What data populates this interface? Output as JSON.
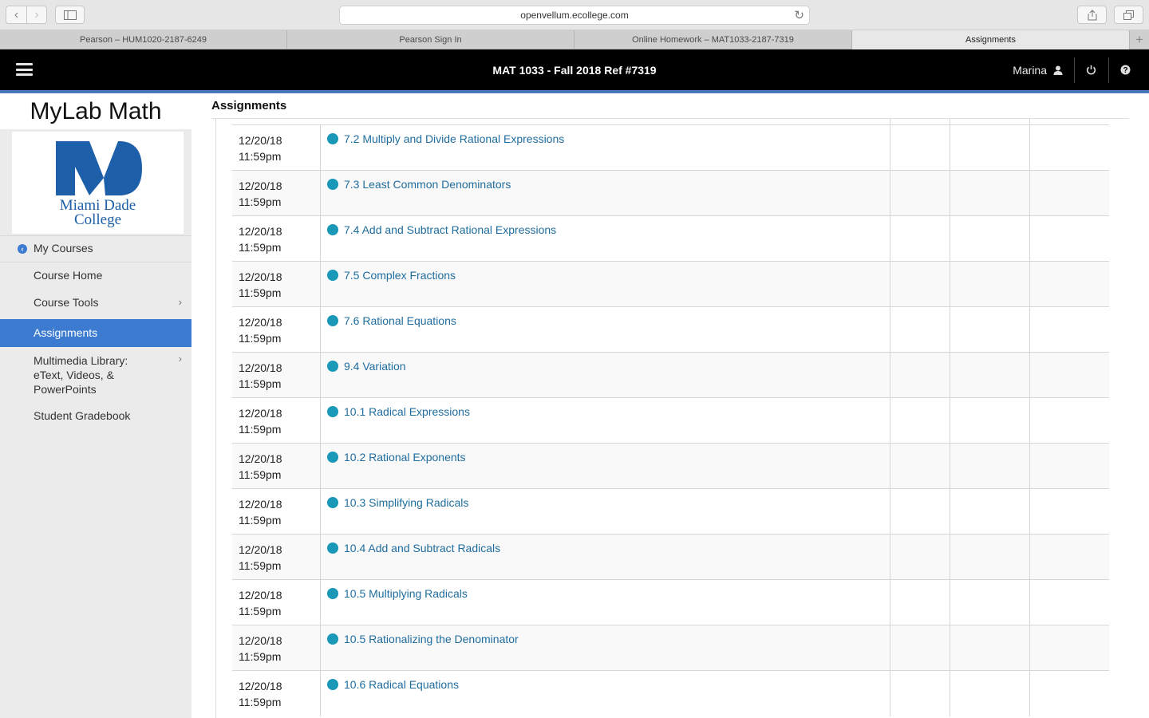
{
  "browser": {
    "url": "openvellum.ecollege.com",
    "tabs": [
      {
        "label": "Pearson – HUM1020-2187-6249",
        "active": false
      },
      {
        "label": "Pearson Sign In",
        "active": false
      },
      {
        "label": "Online Homework – MAT1033-2187-7319",
        "active": false
      },
      {
        "label": "Assignments",
        "active": true
      }
    ],
    "new_tab": "+"
  },
  "header": {
    "course_title": "MAT 1033 - Fall 2018 Ref #7319",
    "user": "Marina",
    "icons": [
      "menu-icon",
      "user-icon",
      "power-icon",
      "help-icon"
    ]
  },
  "sidebar": {
    "brand": "MyLab Math",
    "logo": {
      "line1": "Miami Dade",
      "line2": "College"
    },
    "items": [
      {
        "label": "My Courses",
        "icon": "back-circle-icon"
      },
      {
        "label": "Course Home"
      },
      {
        "label": "Course Tools",
        "icon": "chevron-right-icon"
      },
      {
        "label": "Assignments",
        "active": true
      },
      {
        "label": "Multimedia Library:",
        "line2": "eText, Videos, &",
        "line3": "PowerPoints",
        "icon": "chevron-right-icon"
      },
      {
        "label": "Student Gradebook"
      }
    ]
  },
  "main": {
    "title": "Assignments",
    "rows": [
      {
        "date": "12/20/18",
        "time": "11:59pm",
        "title": "7.2 Multiply and Divide Rational Expressions"
      },
      {
        "date": "12/20/18",
        "time": "11:59pm",
        "title": "7.3 Least Common Denominators"
      },
      {
        "date": "12/20/18",
        "time": "11:59pm",
        "title": "7.4 Add and Subtract Rational Expressions"
      },
      {
        "date": "12/20/18",
        "time": "11:59pm",
        "title": "7.5 Complex Fractions"
      },
      {
        "date": "12/20/18",
        "time": "11:59pm",
        "title": "7.6 Rational Equations"
      },
      {
        "date": "12/20/18",
        "time": "11:59pm",
        "title": "9.4 Variation"
      },
      {
        "date": "12/20/18",
        "time": "11:59pm",
        "title": "10.1 Radical Expressions"
      },
      {
        "date": "12/20/18",
        "time": "11:59pm",
        "title": "10.2 Rational Exponents"
      },
      {
        "date": "12/20/18",
        "time": "11:59pm",
        "title": "10.3 Simplifying Radicals"
      },
      {
        "date": "12/20/18",
        "time": "11:59pm",
        "title": "10.4 Add and Subtract Radicals"
      },
      {
        "date": "12/20/18",
        "time": "11:59pm",
        "title": "10.5 Multiplying Radicals"
      },
      {
        "date": "12/20/18",
        "time": "11:59pm",
        "title": "10.5 Rationalizing the Denominator"
      },
      {
        "date": "12/20/18",
        "time": "11:59pm",
        "title": "10.6 Radical Equations"
      }
    ]
  },
  "colors": {
    "header_bg": "#000000",
    "accent_blue": "#3d7bd1",
    "status_dot": "#1a98b8",
    "link": "#1f6d9e"
  }
}
